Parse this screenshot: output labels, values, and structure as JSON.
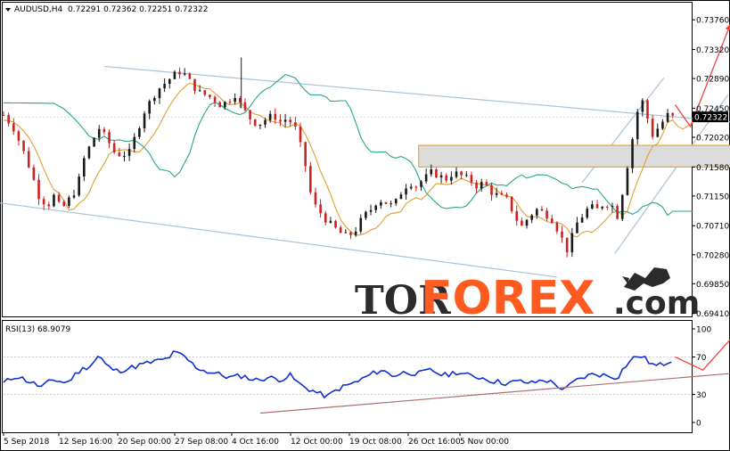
{
  "header": {
    "symbol_label": "AUDUSD,H4",
    "ohlc": "0.72291 0.72362 0.72251 0.72322"
  },
  "rsi_header": {
    "label": "RSI(13) 68.9079"
  },
  "watermark": {
    "part1": "TOR",
    "part2": "FOREX",
    "part3": ".com"
  },
  "colors": {
    "bull": "#1a1a1a",
    "bear": "#cc2222",
    "ma_fast": "#e0a030",
    "ma_slow": "#2aa68a",
    "channel": "#a9c3d6",
    "zone": "#f0a330",
    "rsi": "#1030d0",
    "rsi_trend": "#b07070",
    "arrow": "#ee4444"
  },
  "chart_data": [
    {
      "type": "candlestick",
      "symbol": "AUDUSD",
      "timeframe": "H4",
      "x_ticks": [
        "5 Sep 2018",
        "12 Sep 16:00",
        "20 Sep 00:00",
        "27 Sep 08:00",
        "4 Oct 16:00",
        "12 Oct 00:00",
        "19 Oct 08:00",
        "26 Oct 16:00",
        "5 Nov 00:00"
      ],
      "y_ticks": [
        "0.73760",
        "0.73320",
        "0.72890",
        "0.72450",
        "0.72020",
        "0.71580",
        "0.71150",
        "0.70710",
        "0.70280",
        "0.69850",
        "0.69410"
      ],
      "ylim": [
        0.6938,
        0.74
      ],
      "last_price": "0.72322",
      "close_path": [
        [
          0,
          0.7235
        ],
        [
          8,
          0.7215
        ],
        [
          15,
          0.7185
        ],
        [
          22,
          0.715
        ],
        [
          28,
          0.7115
        ],
        [
          35,
          0.71
        ],
        [
          40,
          0.7115
        ],
        [
          46,
          0.7095
        ],
        [
          52,
          0.711
        ],
        [
          58,
          0.7125
        ],
        [
          64,
          0.717
        ],
        [
          70,
          0.7195
        ],
        [
          76,
          0.7215
        ],
        [
          82,
          0.72
        ],
        [
          88,
          0.718
        ],
        [
          94,
          0.7175
        ],
        [
          100,
          0.718
        ],
        [
          106,
          0.721
        ],
        [
          112,
          0.724
        ],
        [
          118,
          0.726
        ],
        [
          124,
          0.7275
        ],
        [
          130,
          0.7285
        ],
        [
          136,
          0.7295
        ],
        [
          142,
          0.73
        ],
        [
          148,
          0.7285
        ],
        [
          154,
          0.727
        ],
        [
          160,
          0.7265
        ],
        [
          166,
          0.726
        ],
        [
          172,
          0.725
        ],
        [
          178,
          0.7255
        ],
        [
          184,
          0.7265
        ],
        [
          190,
          0.7245
        ],
        [
          196,
          0.723
        ],
        [
          202,
          0.722
        ],
        [
          208,
          0.7228
        ],
        [
          214,
          0.7235
        ],
        [
          220,
          0.7225
        ],
        [
          226,
          0.723
        ],
        [
          232,
          0.7215
        ],
        [
          236,
          0.719
        ],
        [
          240,
          0.716
        ],
        [
          244,
          0.712
        ],
        [
          248,
          0.71
        ],
        [
          252,
          0.709
        ],
        [
          256,
          0.708
        ],
        [
          262,
          0.707
        ],
        [
          268,
          0.706
        ],
        [
          274,
          0.7055
        ],
        [
          280,
          0.7065
        ],
        [
          286,
          0.7085
        ],
        [
          292,
          0.7095
        ],
        [
          298,
          0.711
        ],
        [
          304,
          0.7105
        ],
        [
          310,
          0.71
        ],
        [
          316,
          0.712
        ],
        [
          322,
          0.7135
        ],
        [
          328,
          0.713
        ],
        [
          334,
          0.714
        ],
        [
          340,
          0.715
        ],
        [
          346,
          0.7145
        ],
        [
          352,
          0.714
        ],
        [
          358,
          0.715
        ],
        [
          364,
          0.7145
        ],
        [
          370,
          0.714
        ],
        [
          376,
          0.713
        ],
        [
          382,
          0.7135
        ],
        [
          388,
          0.712
        ],
        [
          394,
          0.7115
        ],
        [
          400,
          0.711
        ],
        [
          404,
          0.7095
        ],
        [
          408,
          0.708
        ],
        [
          412,
          0.707
        ],
        [
          418,
          0.7085
        ],
        [
          424,
          0.7095
        ],
        [
          430,
          0.709
        ],
        [
          436,
          0.708
        ],
        [
          442,
          0.706
        ],
        [
          448,
          0.7035
        ],
        [
          452,
          0.7055
        ],
        [
          456,
          0.7075
        ],
        [
          460,
          0.7085
        ],
        [
          466,
          0.71
        ],
        [
          472,
          0.7095
        ],
        [
          478,
          0.7105
        ],
        [
          484,
          0.71
        ],
        [
          488,
          0.7085
        ],
        [
          492,
          0.712
        ],
        [
          496,
          0.716
        ],
        [
          500,
          0.72
        ],
        [
          504,
          0.724
        ],
        [
          508,
          0.7255
        ],
        [
          512,
          0.723
        ],
        [
          516,
          0.7205
        ],
        [
          520,
          0.7215
        ],
        [
          524,
          0.7225
        ],
        [
          528,
          0.7235
        ],
        [
          532,
          0.7232
        ]
      ]
    },
    {
      "type": "line",
      "indicator": "RSI",
      "period": 13,
      "value": 68.9079,
      "y_ticks": [
        "100",
        "70",
        "30",
        "0"
      ],
      "ylim": [
        0,
        100
      ],
      "values": [
        [
          0,
          42
        ],
        [
          10,
          50
        ],
        [
          20,
          44
        ],
        [
          30,
          38
        ],
        [
          40,
          46
        ],
        [
          50,
          42
        ],
        [
          60,
          55
        ],
        [
          70,
          62
        ],
        [
          76,
          72
        ],
        [
          82,
          60
        ],
        [
          90,
          55
        ],
        [
          100,
          58
        ],
        [
          110,
          62
        ],
        [
          120,
          65
        ],
        [
          130,
          68
        ],
        [
          136,
          75
        ],
        [
          144,
          70
        ],
        [
          152,
          60
        ],
        [
          160,
          55
        ],
        [
          170,
          52
        ],
        [
          180,
          48
        ],
        [
          190,
          50
        ],
        [
          200,
          45
        ],
        [
          210,
          48
        ],
        [
          220,
          46
        ],
        [
          228,
          50
        ],
        [
          236,
          40
        ],
        [
          244,
          35
        ],
        [
          252,
          30
        ],
        [
          258,
          28
        ],
        [
          266,
          36
        ],
        [
          274,
          40
        ],
        [
          282,
          44
        ],
        [
          290,
          50
        ],
        [
          300,
          56
        ],
        [
          310,
          50
        ],
        [
          320,
          54
        ],
        [
          330,
          52
        ],
        [
          340,
          56
        ],
        [
          350,
          50
        ],
        [
          360,
          54
        ],
        [
          370,
          50
        ],
        [
          380,
          48
        ],
        [
          390,
          44
        ],
        [
          400,
          42
        ],
        [
          410,
          44
        ],
        [
          420,
          42
        ],
        [
          430,
          46
        ],
        [
          440,
          40
        ],
        [
          446,
          34
        ],
        [
          452,
          42
        ],
        [
          460,
          48
        ],
        [
          470,
          52
        ],
        [
          480,
          50
        ],
        [
          488,
          48
        ],
        [
          494,
          60
        ],
        [
          500,
          68
        ],
        [
          506,
          72
        ],
        [
          512,
          66
        ],
        [
          518,
          60
        ],
        [
          524,
          62
        ],
        [
          532,
          68
        ]
      ]
    }
  ]
}
